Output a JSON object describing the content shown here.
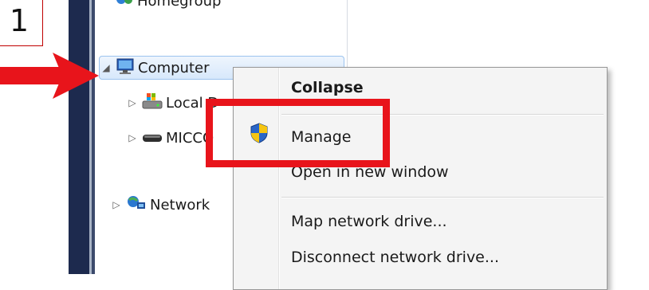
{
  "annotation": {
    "step_number": "1"
  },
  "nav_tree": {
    "items": [
      {
        "label": "Homegroup",
        "icon": "homegroup-icon"
      },
      {
        "label": "Computer",
        "icon": "computer-icon",
        "expander": "◢",
        "selected": true
      },
      {
        "label": "Local D",
        "icon": "local-disk-icon",
        "expander": "▷"
      },
      {
        "label": "MICCO",
        "icon": "removable-drive-icon",
        "expander": "▷"
      },
      {
        "label": "Network",
        "icon": "network-icon",
        "expander": "▷"
      }
    ]
  },
  "context_menu": {
    "items": [
      {
        "label": "Collapse",
        "bold": true
      },
      {
        "label": "Manage",
        "icon": "uac-shield-icon"
      },
      {
        "label": "Open in new window"
      },
      {
        "label": "Map network drive..."
      },
      {
        "label": "Disconnect network drive..."
      }
    ]
  },
  "colors": {
    "highlight": "#e8141b",
    "arrow": "#e8141b",
    "selection": "#d7e8fb",
    "sidebar": "#1d2a4e"
  }
}
